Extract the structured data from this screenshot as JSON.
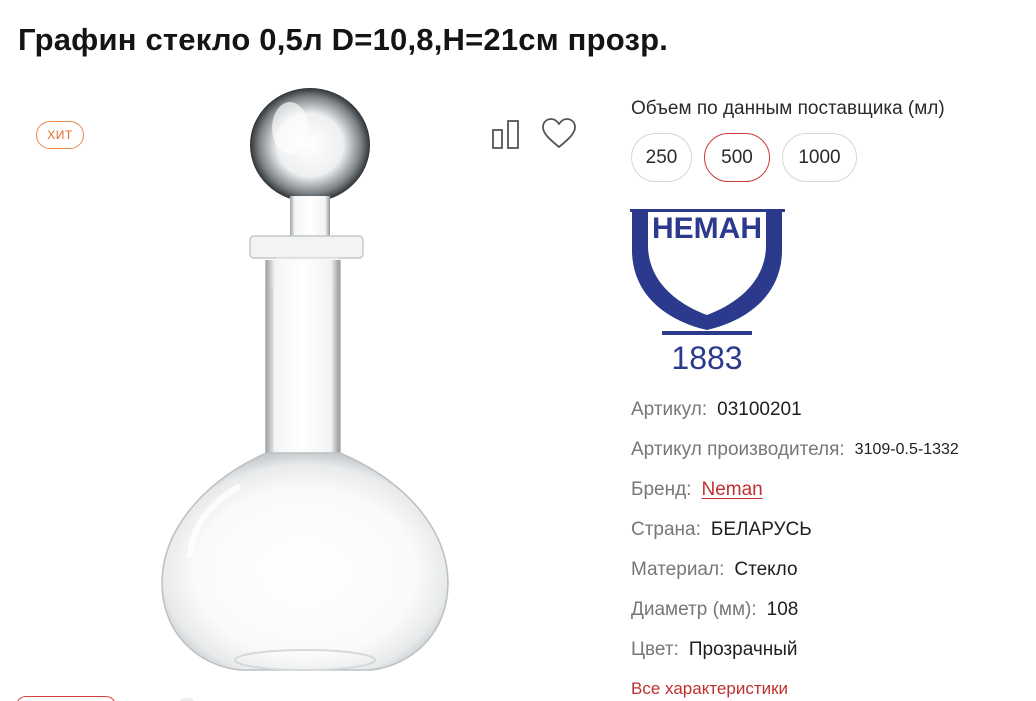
{
  "product": {
    "title": "Графин стекло 0,5л D=10,8,H=21см прозр.",
    "badge": "ХИТ"
  },
  "icons": {
    "compare": "compare-bars-icon",
    "favorite": "heart-icon"
  },
  "volume": {
    "label": "Объем по данным поставщика (мл)",
    "options": [
      "250",
      "500",
      "1000"
    ],
    "selected": "500"
  },
  "brand_logo": {
    "text": "НЕМАН",
    "year": "1883",
    "color": "#2b3a8c"
  },
  "specs": {
    "article_label": "Артикул:",
    "article_value": "03100201",
    "manufacturer_article_label": "Артикул производителя:",
    "manufacturer_article_value": "3109-0.5-1332",
    "brand_label": "Бренд:",
    "brand_value": "Neman",
    "country_label": "Страна:",
    "country_value": "БЕЛАРУСЬ",
    "material_label": "Материал:",
    "material_value": "Стекло",
    "diameter_label": "Диаметр (мм):",
    "diameter_value": "108",
    "color_label": "Цвет:",
    "color_value": "Прозрачный"
  },
  "all_specs_link": "Все характеристики",
  "colors": {
    "accent_red": "#c03030",
    "badge_orange": "#e06a2b",
    "label_gray": "#777777"
  }
}
